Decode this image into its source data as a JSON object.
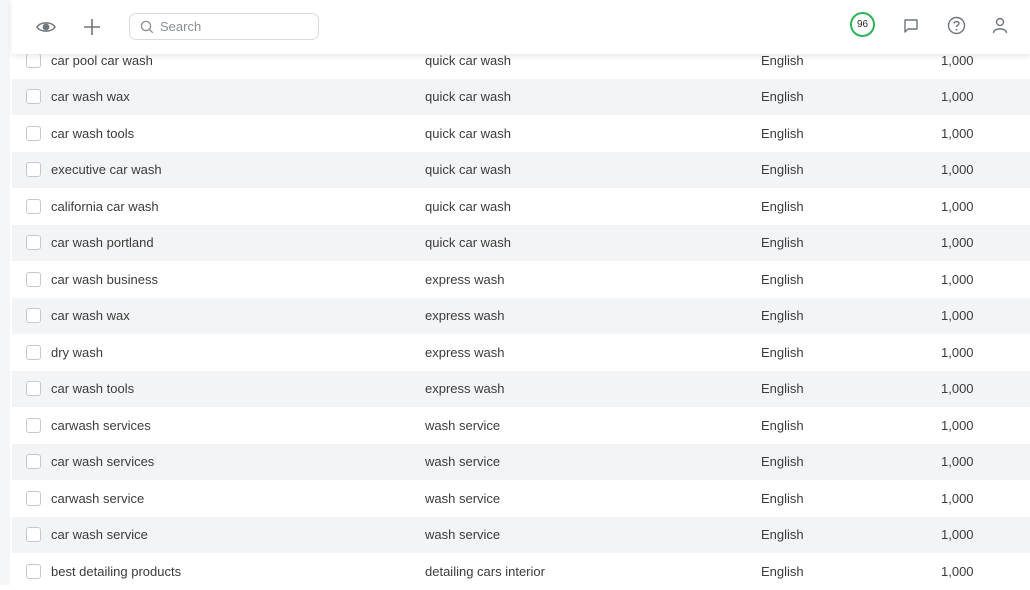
{
  "header": {
    "search_placeholder": "Search",
    "score": "96"
  },
  "rows": [
    {
      "keyword": "car pool car wash",
      "group": "quick car wash",
      "language": "English",
      "volume": "1,000"
    },
    {
      "keyword": "car wash wax",
      "group": "quick car wash",
      "language": "English",
      "volume": "1,000"
    },
    {
      "keyword": "car wash tools",
      "group": "quick car wash",
      "language": "English",
      "volume": "1,000"
    },
    {
      "keyword": "executive car wash",
      "group": "quick car wash",
      "language": "English",
      "volume": "1,000"
    },
    {
      "keyword": "california car wash",
      "group": "quick car wash",
      "language": "English",
      "volume": "1,000"
    },
    {
      "keyword": "car wash portland",
      "group": "quick car wash",
      "language": "English",
      "volume": "1,000"
    },
    {
      "keyword": "car wash business",
      "group": "express wash",
      "language": "English",
      "volume": "1,000"
    },
    {
      "keyword": "car wash wax",
      "group": "express wash",
      "language": "English",
      "volume": "1,000"
    },
    {
      "keyword": "dry wash",
      "group": "express wash",
      "language": "English",
      "volume": "1,000"
    },
    {
      "keyword": "car wash tools",
      "group": "express wash",
      "language": "English",
      "volume": "1,000"
    },
    {
      "keyword": "carwash services",
      "group": "wash service",
      "language": "English",
      "volume": "1,000"
    },
    {
      "keyword": "car wash services",
      "group": "wash service",
      "language": "English",
      "volume": "1,000"
    },
    {
      "keyword": "carwash service",
      "group": "wash service",
      "language": "English",
      "volume": "1,000"
    },
    {
      "keyword": "car wash service",
      "group": "wash service",
      "language": "English",
      "volume": "1,000"
    },
    {
      "keyword": "best detailing products",
      "group": "detailing cars interior",
      "language": "English",
      "volume": "1,000"
    }
  ]
}
